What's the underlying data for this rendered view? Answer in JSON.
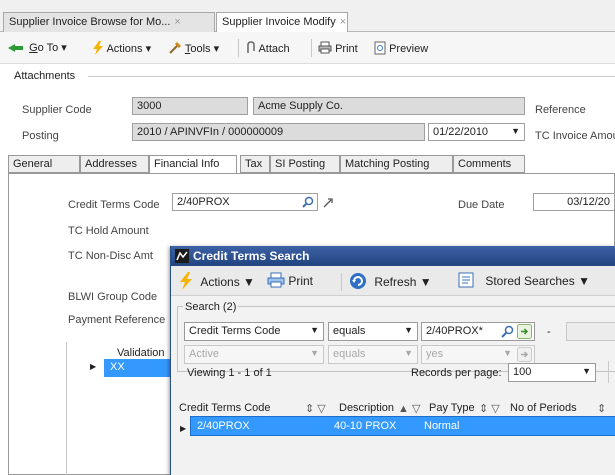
{
  "tabs": [
    {
      "label": "Supplier Invoice Browse for Mo...",
      "close": "×"
    },
    {
      "label": "Supplier Invoice Modify",
      "close": "×"
    }
  ],
  "toolbar": {
    "goto_prefix": "G",
    "goto_rest": "o To",
    "actions": "Actions",
    "tools_prefix": "T",
    "tools_rest": "ools",
    "attach": "Attach",
    "print": "Print",
    "preview": "Preview"
  },
  "attachments_label": "Attachments",
  "header": {
    "supplier_code_label": "Supplier Code",
    "supplier_code": "3000",
    "supplier_name": "Acme Supply Co.",
    "reference_label": "Reference",
    "posting_label": "Posting",
    "posting_value": "2010 / APINVFIn / 000000009",
    "posting_date": "01/22/2010",
    "tc_invoice_label": "TC Invoice Amou"
  },
  "inner_tabs": [
    "General",
    "Addresses",
    "Financial Info",
    "Tax",
    "SI Posting",
    "Matching Posting",
    "Comments"
  ],
  "form": {
    "credit_terms_label": "Credit Terms Code",
    "credit_terms_value": "2/40PROX",
    "due_date_label": "Due Date",
    "due_date_value": "03/12/20",
    "tc_hold_label": "TC Hold Amount",
    "tc_nondisc_label": "TC Non-Disc Amt",
    "blwi_label": "BLWI Group Code",
    "payment_ref_label": "Payment Reference",
    "validation_header": "Validation",
    "validation_value": "XX"
  },
  "dialog": {
    "title": "Credit Terms Search",
    "actions": "Actions",
    "print": "Print",
    "refresh": "Refresh",
    "stored": "Stored Searches",
    "search_group": "Search (2)",
    "row1": {
      "field": "Credit Terms Code",
      "op": "equals",
      "value": "2/40PROX*"
    },
    "row2": {
      "field": "Active",
      "op": "equals",
      "value": "yes"
    },
    "dash": "-",
    "viewing": "Viewing 1 - 1 of 1",
    "records_label": "Records per page:",
    "records_value": "100",
    "columns": [
      "Credit Terms Code",
      "Description",
      "Pay Type",
      "No of Periods"
    ],
    "rows": [
      {
        "code": "2/40PROX",
        "description": "40-10 PROX",
        "pay_type": "Normal"
      }
    ]
  },
  "colors": {
    "accent": "#3399ff",
    "title_bar": "#2a4e8a"
  }
}
